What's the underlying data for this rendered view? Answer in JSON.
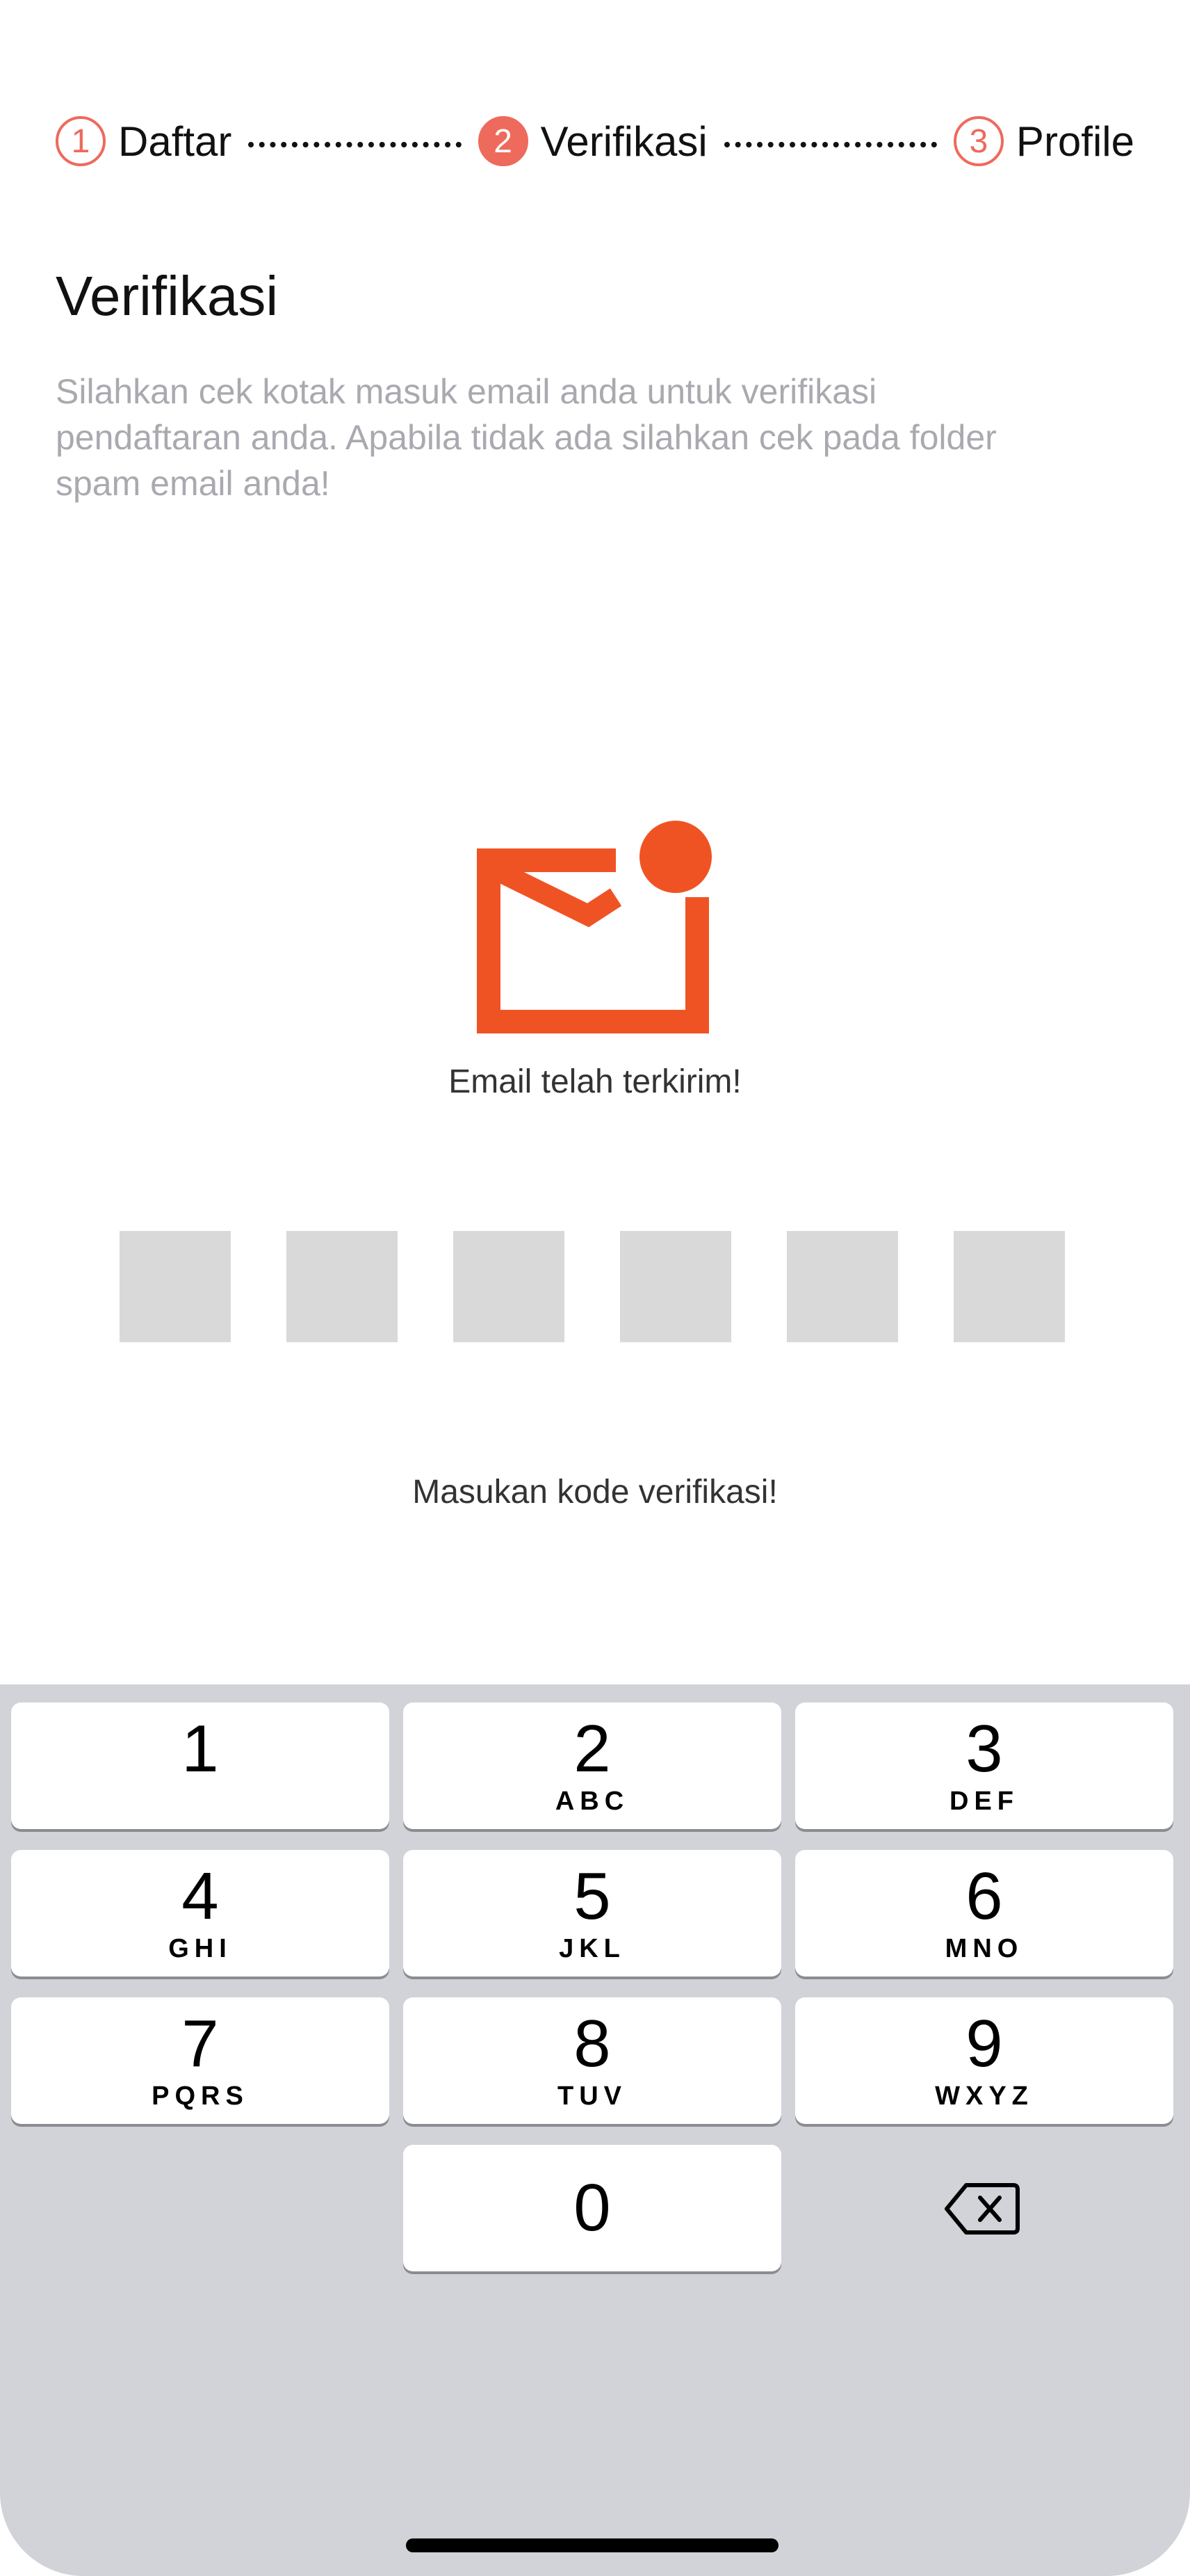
{
  "stepper": {
    "steps": [
      {
        "number": "1",
        "label": "Daftar",
        "active": false
      },
      {
        "number": "2",
        "label": "Verifikasi",
        "active": true
      },
      {
        "number": "3",
        "label": "Profile",
        "active": false
      }
    ]
  },
  "page": {
    "title": "Verifikasi",
    "description": "Silahkan cek kotak masuk email anda untuk verifikasi pendaftaran anda. Apabila tidak ada silahkan cek pada folder spam email anda!"
  },
  "mail": {
    "icon": "mail-notification-icon",
    "caption": "Email telah terkirim!",
    "color": "#f05323"
  },
  "otp": {
    "hint": "Masukan kode verifikasi!",
    "length": 6
  },
  "keypad": {
    "keys": [
      {
        "num": "1",
        "letters": ""
      },
      {
        "num": "2",
        "letters": "ABC"
      },
      {
        "num": "3",
        "letters": "DEF"
      },
      {
        "num": "4",
        "letters": "GHI"
      },
      {
        "num": "5",
        "letters": "JKL"
      },
      {
        "num": "6",
        "letters": "MNO"
      },
      {
        "num": "7",
        "letters": "PQRS"
      },
      {
        "num": "8",
        "letters": "TUV"
      },
      {
        "num": "9",
        "letters": "WXYZ"
      },
      {
        "num": "0",
        "letters": ""
      }
    ],
    "backspace_icon": "backspace-icon"
  },
  "colors": {
    "accent": "#ee6a5c",
    "mail": "#f05323",
    "otp_box": "#d9d9d9",
    "keyboard_bg": "#d1d3d9"
  }
}
